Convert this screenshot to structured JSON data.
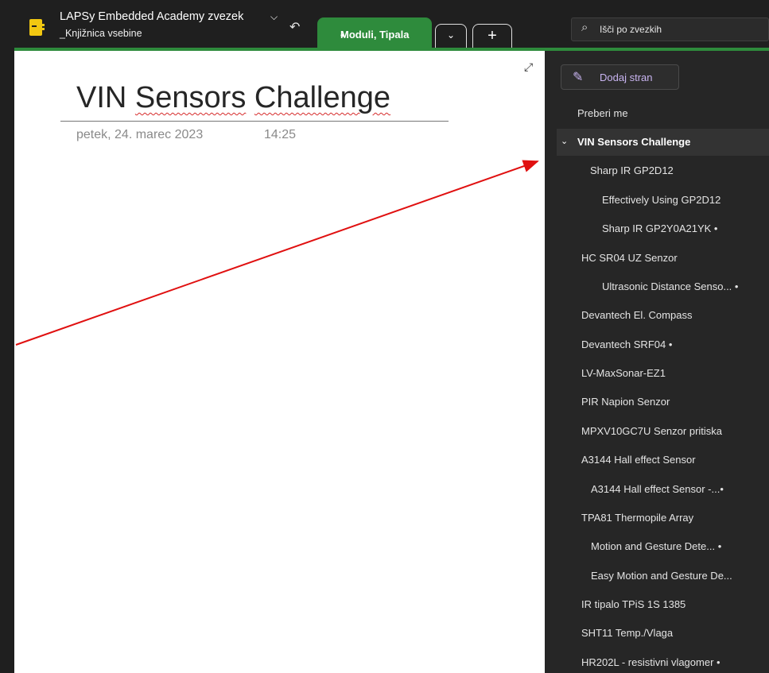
{
  "notebook": {
    "title": "LAPSy Embedded Academy zvezek",
    "subtitle": "_Knjižnica vsebine"
  },
  "tabs": {
    "active_label": "Moduli, Tipala",
    "active_dot": "•",
    "more_label": "⌄",
    "add_label": "+"
  },
  "search": {
    "placeholder": "Išči po zvezkih"
  },
  "page": {
    "title_word1": "VIN",
    "title_word2": "Sensors",
    "title_word3": "Challenge",
    "date": "petek, 24. marec 2023",
    "time": "14:25"
  },
  "sidebar": {
    "add_page_label": "Dodaj stran",
    "pages": [
      {
        "label": "Preberi me",
        "level": 0
      },
      {
        "label": "VIN Sensors Challenge",
        "level": 0,
        "selected": true
      },
      {
        "label": "Sharp IR GP2D12",
        "level": 1
      },
      {
        "label": "Effectively Using GP2D12",
        "level": 2
      },
      {
        "label": "Sharp IR GP2Y0A21YK •",
        "level": 2
      },
      {
        "label": "HC SR04 UZ Senzor",
        "level": 1
      },
      {
        "label": "Ultrasonic Distance Senso... •",
        "level": 2
      },
      {
        "label": "Devantech El. Compass",
        "level": 1
      },
      {
        "label": "Devantech SRF04 •",
        "level": 1
      },
      {
        "label": "LV-MaxSonar-EZ1",
        "level": 1
      },
      {
        "label": "PIR Napion Senzor",
        "level": 1
      },
      {
        "label": "MPXV10GC7U Senzor pritiska",
        "level": 1
      },
      {
        "label": "A3144 Hall effect Sensor",
        "level": 1
      },
      {
        "label": "A3144 Hall effect Sensor -...•",
        "level": 2
      },
      {
        "label": "TPA81 Thermopile Array",
        "level": 1
      },
      {
        "label": "Motion and Gesture Dete... •",
        "level": 2
      },
      {
        "label": "Easy Motion and Gesture De...",
        "level": 2
      },
      {
        "label": "IR tipalo TPiS 1S 1385",
        "level": 1
      },
      {
        "label": "SHT11 Temp./Vlaga",
        "level": 1
      },
      {
        "label": "HR202L - resistivni vlagomer •",
        "level": 1
      }
    ]
  },
  "icons": {
    "notebook": "notebook-icon",
    "undo": "undo-icon",
    "search": "search-icon",
    "expand": "expand-icon",
    "add_page": "new-page-icon",
    "collapse": "chevron-down-icon"
  },
  "colors": {
    "accent_green": "#2e8b3c",
    "notebook_yellow": "#f2c811",
    "annotation_arrow": "#e01010"
  }
}
